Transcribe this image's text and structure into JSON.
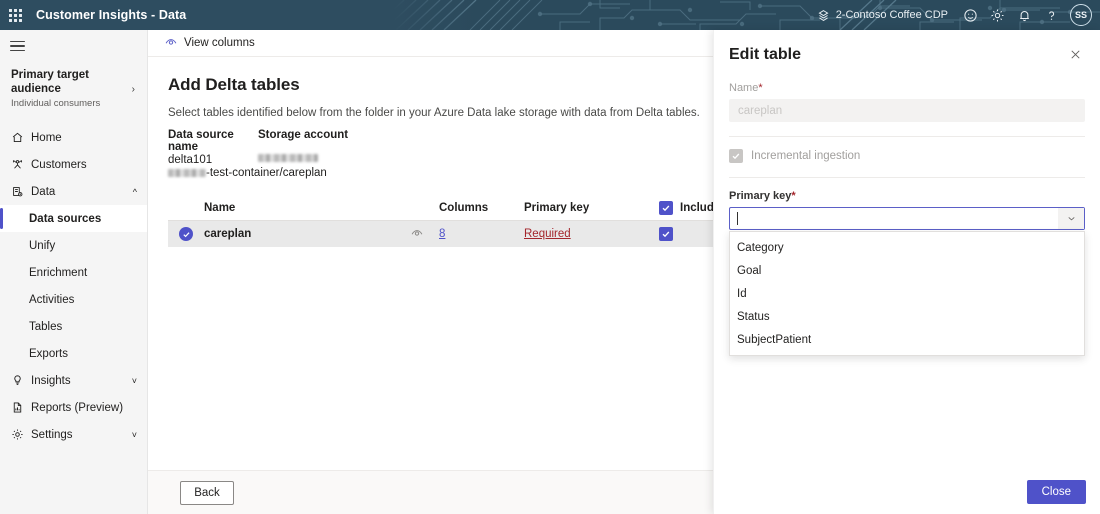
{
  "header": {
    "waffle_name": "app-launcher",
    "title": "Customer Insights - Data",
    "environment": "2-Contoso Coffee CDP",
    "icons": [
      "feedback-icon",
      "gear-icon",
      "bell-icon",
      "help-icon"
    ],
    "avatar_initials": "SS",
    "background_color": "#2b4a5c"
  },
  "sidebar": {
    "audience": {
      "title": "Primary target audience",
      "subtitle": "Individual consumers"
    },
    "items": [
      {
        "label": "Home",
        "icon": "home-icon",
        "level": "top",
        "expandable": false,
        "active": false
      },
      {
        "label": "Customers",
        "icon": "customers-icon",
        "level": "top",
        "expandable": false,
        "active": false
      },
      {
        "label": "Data",
        "icon": "data-icon",
        "level": "top",
        "expandable": true,
        "expanded": true,
        "active": false
      },
      {
        "label": "Data sources",
        "icon": "",
        "level": "child",
        "expandable": false,
        "active": true
      },
      {
        "label": "Unify",
        "icon": "",
        "level": "child",
        "expandable": false,
        "active": false
      },
      {
        "label": "Enrichment",
        "icon": "",
        "level": "child",
        "expandable": false,
        "active": false
      },
      {
        "label": "Activities",
        "icon": "",
        "level": "child",
        "expandable": false,
        "active": false
      },
      {
        "label": "Tables",
        "icon": "",
        "level": "child",
        "expandable": false,
        "active": false
      },
      {
        "label": "Exports",
        "icon": "",
        "level": "child",
        "expandable": false,
        "active": false
      },
      {
        "label": "Insights",
        "icon": "lightbulb-icon",
        "level": "top",
        "expandable": true,
        "expanded": false,
        "active": false
      },
      {
        "label": "Reports (Preview)",
        "icon": "report-icon",
        "level": "top",
        "expandable": false,
        "active": false
      },
      {
        "label": "Settings",
        "icon": "gear-icon",
        "level": "top",
        "expandable": true,
        "expanded": false,
        "active": false
      }
    ]
  },
  "commandbar": {
    "view_columns_label": "View columns",
    "view_columns_icon": "eye-icon"
  },
  "main": {
    "page_title": "Add Delta tables",
    "description": "Select tables identified below from the folder in your Azure Data lake storage with data from Delta tables.",
    "meta": {
      "col_data_source_name": "Data source name",
      "col_storage_account": "Storage account",
      "data_source_name": "delta101",
      "storage_account": "",
      "path_suffix": "-test-container/careplan"
    },
    "table": {
      "columns": [
        "Name",
        "Columns",
        "Primary key",
        "Include"
      ],
      "include_header_checked": true,
      "include_info_icon": "info-icon",
      "rows": [
        {
          "selected": true,
          "name": "careplan",
          "preview_icon": "eye-icon",
          "columns_count": "8",
          "primary_key": "Required",
          "include_checked": true
        }
      ]
    },
    "back_button": "Back"
  },
  "panel": {
    "title": "Edit table",
    "close_icon": "close-icon",
    "name_label": "Name",
    "name_required_mark": "*",
    "name_value": "careplan",
    "name_disabled": true,
    "incremental_label": "Incremental ingestion",
    "incremental_checked": true,
    "incremental_disabled": true,
    "primary_key_label": "Primary key",
    "primary_key_required_mark": "*",
    "primary_key_value": "",
    "primary_key_expanded": true,
    "primary_key_options": [
      "Category",
      "Goal",
      "Id",
      "Status",
      "SubjectPatient"
    ],
    "close_button": "Close"
  },
  "colors": {
    "accent": "#4f52c9",
    "header_bg": "#2b4a5c",
    "error_red": "#a4262c",
    "row_bg": "#e9e9e9"
  }
}
